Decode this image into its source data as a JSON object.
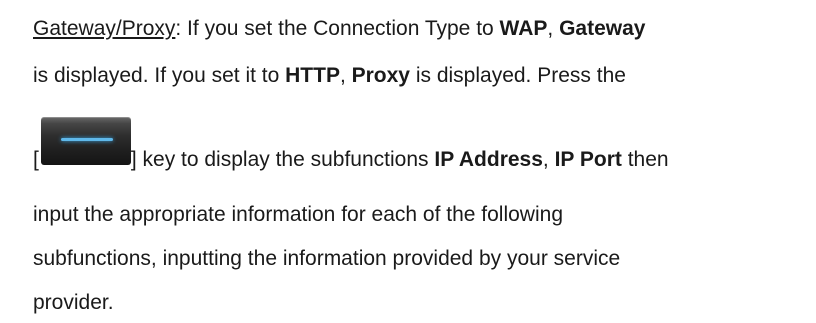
{
  "paragraph": {
    "term": "Gateway/Proxy",
    "line1_a": ": If you set the Connection Type to ",
    "line1_b1": "WAP",
    "line1_sep": ", ",
    "line1_b2": "Gateway",
    "line2_a": "is displayed. If you set it to ",
    "line2_b1": "HTTP",
    "line2_sep": ", ",
    "line2_b2": "Proxy",
    "line2_c": " is displayed. Press the",
    "line3_open": "[",
    "line3_close": "] key to display the subfunctions ",
    "line3_b1": "IP Address",
    "line3_sep": ", ",
    "line3_b2": "IP Port",
    "line3_c": " then",
    "line4": "input the appropriate information for each of the following",
    "line5": "subfunctions, inputting the information provided by your service",
    "line6": "provider."
  },
  "key_icon": "navigation-key-icon",
  "colors": {
    "text": "#1a1a1a",
    "key_accent": "#5fb8ea"
  }
}
